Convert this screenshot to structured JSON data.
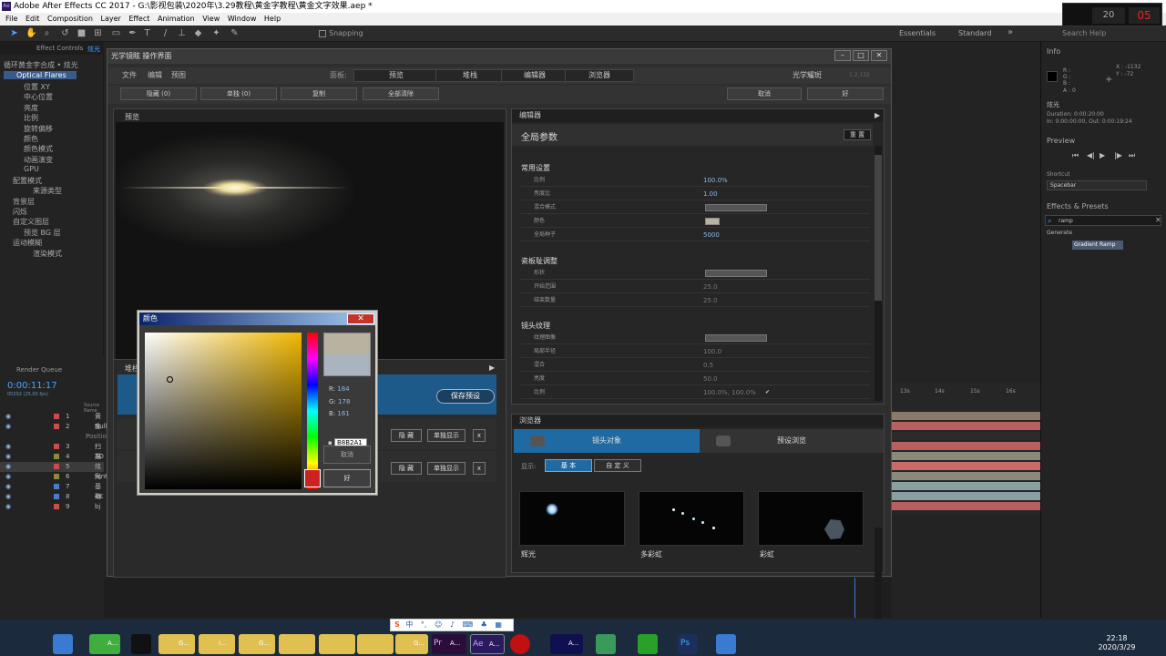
{
  "app": {
    "title": "Adobe After Effects CC 2017 - G:\\影视包装\\2020年\\3.29教程\\黄金字教程\\黄金文字效果.aep *",
    "menus": [
      "File",
      "Edit",
      "Composition",
      "Layer",
      "Effect",
      "Animation",
      "View",
      "Window",
      "Help"
    ],
    "toolbar": {
      "snapping_label": "Snapping",
      "workspaces": [
        "Essentials",
        "Standard"
      ],
      "search_placeholder": "Search Help"
    }
  },
  "effect_controls": {
    "tab_label": "Effect Controls",
    "tab_target": "炫光",
    "comp_line": "循环黄金字合成 • 炫光",
    "effect_name": "Optical Flares",
    "params": [
      "位置 XY",
      "中心位置",
      "亮度",
      "比例",
      "旋转偏移",
      "颜色",
      "颜色模式",
      "动画演变",
      "GPU",
      "配置模式",
      "来源类型",
      "背景层",
      "闪烁",
      "自定义图层",
      "预览 BG 层",
      "运动模糊",
      "渲染模式"
    ]
  },
  "timeline": {
    "tab_label": "Render Queue",
    "timecode": "0:00:11:17",
    "fps": "00292 (25.00 fps)",
    "column_label": "Source Name",
    "layers": [
      {
        "num": "1",
        "name": "黄金",
        "color": "#c94d4d"
      },
      {
        "num": "2",
        "name": "Null",
        "color": "#c94d4d"
      },
      {
        "num": "",
        "name": "Position",
        "color": ""
      },
      {
        "num": "3",
        "name": "扫描",
        "color": "#c94d4d"
      },
      {
        "num": "4",
        "name": "3D",
        "color": "#8a8a3a"
      },
      {
        "num": "5",
        "name": "炫光",
        "color": "#c94d4d"
      },
      {
        "num": "6",
        "name": "font",
        "color": "#8a8a3a"
      },
      {
        "num": "7",
        "name": "基础",
        "color": "#4d7bc9"
      },
      {
        "num": "8",
        "name": "4K",
        "color": "#4d7bc9"
      },
      {
        "num": "9",
        "name": "bj",
        "color": "#c94d4d"
      }
    ],
    "ruler": [
      "13s",
      "14s",
      "15s",
      "16s",
      "17s",
      "18s",
      "19s",
      "20s"
    ]
  },
  "right_panel": {
    "info_title": "Info",
    "info_rgb": [
      "R :",
      "G :",
      "B :",
      "A : 0"
    ],
    "info_xy": [
      "X : -1132",
      "Y : -72"
    ],
    "layer_name": "炫光",
    "duration": "Duration: 0:00:20:00",
    "in_out": "In: 0:00:00:00, Out: 0:00:19:24",
    "preview_title": "Preview",
    "shortcut_label": "Shortcut",
    "shortcut_value": "Spacebar",
    "effects_title": "Effects & Presets",
    "search_value": "ramp",
    "category": "Generate",
    "result": "Gradient Ramp"
  },
  "flares_dialog": {
    "title": "光学镜眩 操作界面",
    "menu": [
      "文件",
      "编辑",
      "预图"
    ],
    "panels_label": "面板:",
    "panel_tabs": [
      "预览",
      "堆栈",
      "编辑器",
      "浏览器"
    ],
    "brand": "光学耀斑",
    "version": "1.2.132",
    "buttons": [
      "隐藏 (0)",
      "单独 (0)",
      "复制",
      "全部清除"
    ],
    "cancel_label": "取消",
    "ok_label": "好",
    "preview_title": "预览",
    "stack_title": "堆栈",
    "save_preset": "保存预设",
    "hide_label": "隐 藏",
    "solo_label": "单独显示",
    "editor": {
      "title": "编辑器",
      "header": "全局参数",
      "reset": "重 置",
      "sections": [
        {
          "title": "常用设置",
          "rows": [
            {
              "label": "比例",
              "value": "100.0%",
              "kind": "text"
            },
            {
              "label": "亮度比",
              "value": "1.00",
              "kind": "text"
            },
            {
              "label": "混合模式",
              "value": "",
              "kind": "dropdown"
            },
            {
              "label": "颜色",
              "value": "",
              "kind": "swatch"
            },
            {
              "label": "全局种子",
              "value": "5000",
              "kind": "text"
            }
          ]
        },
        {
          "title": "瓷板耻调整",
          "rows": [
            {
              "label": "形状",
              "value": "",
              "kind": "dropdown"
            },
            {
              "label": "开始范围",
              "value": "25.0",
              "kind": "text"
            },
            {
              "label": "结束数量",
              "value": "25.0",
              "kind": "text"
            }
          ]
        },
        {
          "title": "镜头纹理",
          "rows": [
            {
              "label": "纹理图像",
              "value": "",
              "kind": "dropdown"
            },
            {
              "label": "局部半径",
              "value": "100.0",
              "kind": "text"
            },
            {
              "label": "混合",
              "value": "0.5",
              "kind": "text"
            },
            {
              "label": "亮度",
              "value": "50.0",
              "kind": "text"
            },
            {
              "label": "比例",
              "value": "100.0%, 100.0%",
              "kind": "text"
            }
          ]
        }
      ]
    },
    "browser": {
      "title": "浏览器",
      "tabs": [
        "镜头对象",
        "预设浏览"
      ],
      "show_label": "显示:",
      "filter_tabs": [
        "基 本",
        "自 定 义"
      ],
      "thumbs": [
        "辉光",
        "多彩虹",
        "彩虹"
      ]
    }
  },
  "color_picker": {
    "title": "颜色",
    "r_label": "R:",
    "r": "184",
    "g_label": "G:",
    "g": "178",
    "b_label": "B:",
    "b": "161",
    "hex": "B8B2A1",
    "cancel": "取消",
    "ok": "好",
    "new_color": "#b8b2a1",
    "old_color": "#a9b4c0"
  },
  "taskbar": {
    "clock_time": "22:18",
    "clock_date": "2020/3/29",
    "apps": [
      "A...",
      "G...",
      "I...",
      "G...",
      "G...",
      "A...",
      "A...",
      "A..."
    ],
    "ime": "中"
  }
}
